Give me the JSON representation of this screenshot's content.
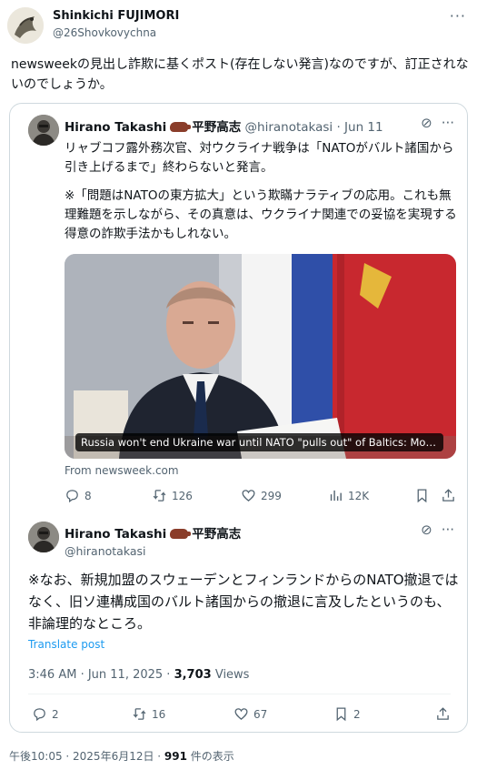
{
  "outer": {
    "name": "Shinkichi FUJIMORI",
    "handle": "@26Shovkovychna",
    "text": "newsweekの見出し詐欺に基くポスト(存在しない発言)なのですが、訂正されないのでしょうか。"
  },
  "quoted": {
    "name": "Hirano Takashi",
    "name_jp": "平野高志",
    "handle": "@hiranotakasi",
    "date": "· Jun 11",
    "paragraph1": "リャブコフ露外務次官、対ウクライナ戦争は「NATOがバルト諸国から引き上げるまで」終わらないと発言。",
    "paragraph2": "※「問題はNATOの東方拡大」という欺瞞ナラティブの応用。これも無理難題を示しながら、その真意は、ウクライナ関連での妥協を実現する得意の詐欺手法かもしれない。",
    "media_caption": "Russia won't end Ukraine war until NATO \"pulls out\" of Baltics: Mos...",
    "from": "From newsweek.com",
    "stats": {
      "replies": "8",
      "reposts": "126",
      "likes": "299",
      "views": "12K"
    }
  },
  "reply": {
    "name": "Hirano Takashi",
    "name_jp": "平野高志",
    "handle": "@hiranotakasi",
    "text": "※なお、新規加盟のスウェーデンとフィンランドからのNATO撤退ではなく、旧ソ連構成国のバルト諸国からの撤退に言及したというのも、非論理的なところ。",
    "translate": "Translate post",
    "time": "3:46 AM · Jun 11, 2025 · ",
    "views_count": "3,703",
    "views_label": " Views",
    "stats": {
      "replies": "2",
      "reposts": "16",
      "likes": "67",
      "bookmarks": "2"
    }
  },
  "footer": {
    "time": "午後10:05 · 2025年6月12日 · ",
    "views": "991",
    "views_label": " 件の表示"
  },
  "colors": {
    "link": "#1d9bf0",
    "muted": "#536471",
    "border": "#cfd9de"
  }
}
